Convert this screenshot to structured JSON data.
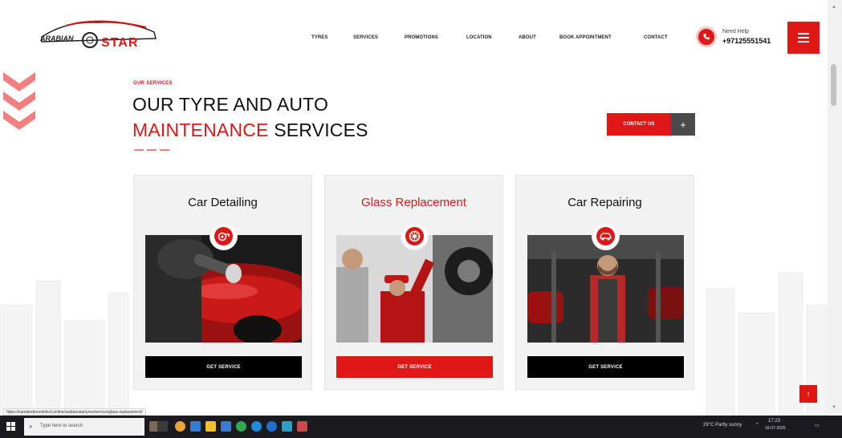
{
  "brand": {
    "logo_text": "STAR",
    "logo_prefix": "ARABIAN"
  },
  "nav": {
    "items": [
      {
        "label": "TYRES"
      },
      {
        "label": "SERVICES"
      },
      {
        "label": "PROMOTIONS"
      },
      {
        "label": "LOCATION"
      },
      {
        "label": "ABOUT"
      },
      {
        "label": "BOOK APPOINTMENT"
      },
      {
        "label": "CONTACT"
      }
    ]
  },
  "help": {
    "label": "Need Help",
    "phone": "+97125551541"
  },
  "section": {
    "eyebrow": "OUR SERVICES",
    "title_line1": "OUR TYRE AND AUTO",
    "title_line2_accent": "MAINTENANCE",
    "title_line2_rest": " SERVICES",
    "cta_label": "CONTACT US",
    "cta_plus": "+"
  },
  "cards": [
    {
      "title": "Car Detailing",
      "button": "GET SERVICE",
      "icon": "turbo-icon"
    },
    {
      "title": "Glass Replacement",
      "button": "GET SERVICE",
      "icon": "wheel-icon"
    },
    {
      "title": "Car Repairing",
      "button": "GET SERVICE",
      "icon": "car-wrench-icon"
    }
  ],
  "status_url": "https://sampledemolinkurl.online/arabianstartyres/service/glass-replacement/",
  "taskbar": {
    "search_placeholder": "Type here to search",
    "weather": "29°C  Partly sunny",
    "time": "17:23",
    "date": "16-07-2025"
  },
  "colors": {
    "accent": "#e01717",
    "dark": "#111111",
    "card_bg": "#f2f2f2"
  }
}
